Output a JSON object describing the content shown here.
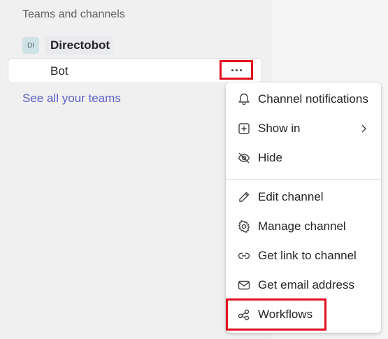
{
  "sidebar": {
    "section_title": "Teams and channels",
    "team": {
      "avatar_text": "DI",
      "name": "Directobot"
    },
    "channel": {
      "name": "Bot"
    },
    "see_all_link": "See all your teams"
  },
  "context_menu": {
    "group1": [
      {
        "label": "Channel notifications",
        "icon": "bell-icon"
      },
      {
        "label": "Show in",
        "icon": "add-square-icon",
        "submenu": true
      },
      {
        "label": "Hide",
        "icon": "eye-off-icon"
      }
    ],
    "group2": [
      {
        "label": "Edit channel",
        "icon": "pencil-icon"
      },
      {
        "label": "Manage channel",
        "icon": "gear-icon"
      },
      {
        "label": "Get link to channel",
        "icon": "link-icon"
      },
      {
        "label": "Get email address",
        "icon": "mail-icon"
      },
      {
        "label": "Workflows",
        "icon": "workflows-icon"
      }
    ]
  },
  "colors": {
    "highlight": "#e0101e",
    "link": "#5b5fc7",
    "avatar_bg": "#cfe2e6"
  }
}
